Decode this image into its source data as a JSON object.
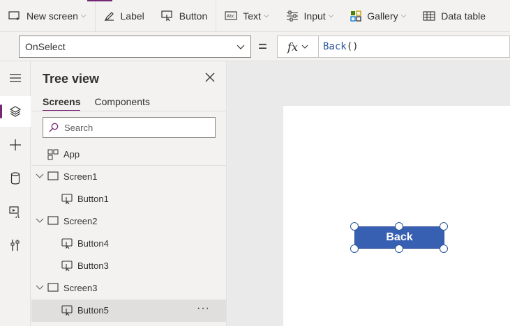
{
  "toolbar": {
    "new_screen": "New screen",
    "label": "Label",
    "button": "Button",
    "text": "Text",
    "input": "Input",
    "gallery": "Gallery",
    "data_table": "Data table"
  },
  "formula_bar": {
    "property": "OnSelect",
    "equals": "=",
    "fx": "fx",
    "formula_fn": "Back",
    "formula_args": "()"
  },
  "tree_view": {
    "title": "Tree view",
    "tabs": [
      "Screens",
      "Components"
    ],
    "search_placeholder": "Search",
    "app_label": "App",
    "items": [
      {
        "label": "Screen1",
        "type": "screen"
      },
      {
        "label": "Button1",
        "type": "button"
      },
      {
        "label": "Screen2",
        "type": "screen"
      },
      {
        "label": "Button4",
        "type": "button"
      },
      {
        "label": "Button3",
        "type": "button"
      },
      {
        "label": "Screen3",
        "type": "screen"
      },
      {
        "label": "Button5",
        "type": "button",
        "selected": true
      }
    ],
    "more": "···"
  },
  "canvas": {
    "button_text": "Back",
    "button_color": "#3860b2"
  },
  "colors": {
    "accent": "#742774",
    "link": "#2b579a"
  }
}
